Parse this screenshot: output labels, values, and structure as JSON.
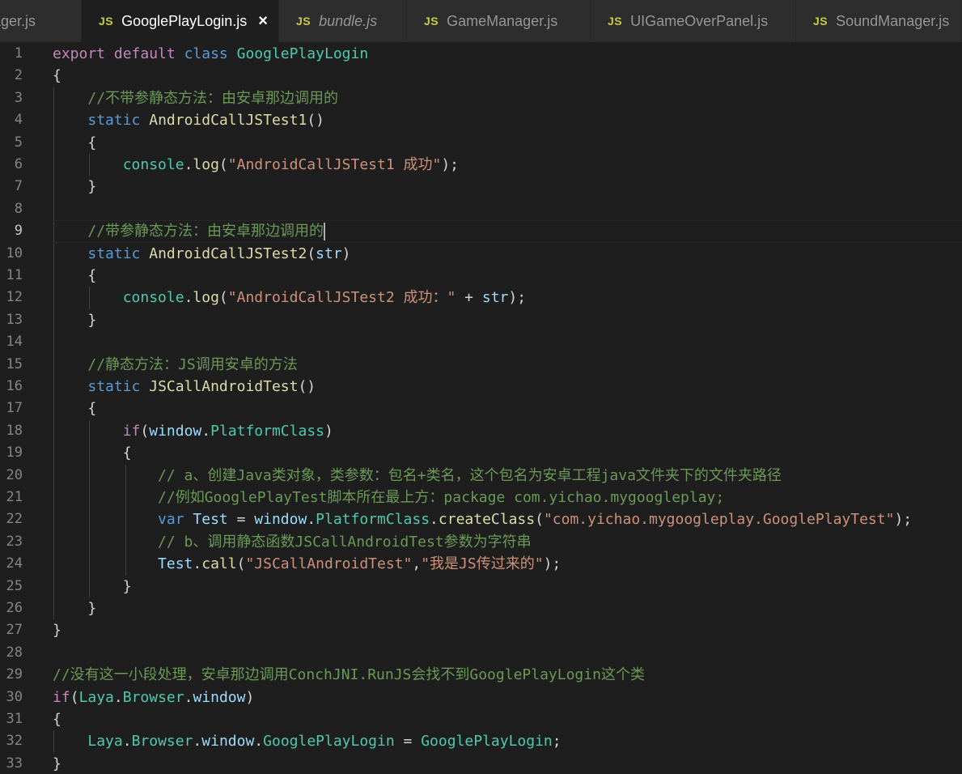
{
  "tabs": [
    {
      "label": "nager.js",
      "icon": "JS",
      "active": false,
      "italic": false
    },
    {
      "label": "GooglePlayLogin.js",
      "icon": "JS",
      "active": true,
      "italic": false,
      "close": "×"
    },
    {
      "label": "bundle.js",
      "icon": "JS",
      "active": false,
      "italic": true
    },
    {
      "label": "GameManager.js",
      "icon": "JS",
      "active": false,
      "italic": false
    },
    {
      "label": "UIGameOverPanel.js",
      "icon": "JS",
      "active": false,
      "italic": false
    },
    {
      "label": "SoundManager.js",
      "icon": "JS",
      "active": false,
      "italic": false
    }
  ],
  "editor": {
    "current_line": 9,
    "line_numbers": [
      "1",
      "2",
      "3",
      "4",
      "5",
      "6",
      "7",
      "8",
      "9",
      "10",
      "11",
      "12",
      "13",
      "14",
      "15",
      "16",
      "17",
      "18",
      "19",
      "20",
      "21",
      "22",
      "23",
      "24",
      "25",
      "26",
      "27",
      "28",
      "29",
      "30",
      "31",
      "32",
      "33"
    ],
    "lines": [
      [
        {
          "t": "kw",
          "v": "export"
        },
        {
          "t": "pl",
          "v": " "
        },
        {
          "t": "kw",
          "v": "default"
        },
        {
          "t": "pl",
          "v": " "
        },
        {
          "t": "st",
          "v": "class"
        },
        {
          "t": "pl",
          "v": " "
        },
        {
          "t": "cls",
          "v": "GooglePlayLogin"
        }
      ],
      [
        {
          "t": "pl",
          "v": "{"
        }
      ],
      [
        {
          "t": "pl",
          "v": "    "
        },
        {
          "t": "cmt",
          "v": "//不带参静态方法：由安卓那边调用的"
        }
      ],
      [
        {
          "t": "pl",
          "v": "    "
        },
        {
          "t": "st",
          "v": "static"
        },
        {
          "t": "pl",
          "v": " "
        },
        {
          "t": "fn",
          "v": "AndroidCallJSTest1"
        },
        {
          "t": "pl",
          "v": "()"
        }
      ],
      [
        {
          "t": "pl",
          "v": "    {"
        }
      ],
      [
        {
          "t": "pl",
          "v": "        "
        },
        {
          "t": "cls",
          "v": "console"
        },
        {
          "t": "pl",
          "v": "."
        },
        {
          "t": "fn",
          "v": "log"
        },
        {
          "t": "pl",
          "v": "("
        },
        {
          "t": "str",
          "v": "\"AndroidCallJSTest1 成功\""
        },
        {
          "t": "pl",
          "v": ");"
        }
      ],
      [
        {
          "t": "pl",
          "v": "    }"
        }
      ],
      [
        {
          "t": "pl",
          "v": ""
        }
      ],
      [
        {
          "t": "pl",
          "v": "    "
        },
        {
          "t": "cmt",
          "v": "//带参静态方法：由安卓那边调用的"
        }
      ],
      [
        {
          "t": "pl",
          "v": "    "
        },
        {
          "t": "st",
          "v": "static"
        },
        {
          "t": "pl",
          "v": " "
        },
        {
          "t": "fn",
          "v": "AndroidCallJSTest2"
        },
        {
          "t": "pl",
          "v": "("
        },
        {
          "t": "var",
          "v": "str"
        },
        {
          "t": "pl",
          "v": ")"
        }
      ],
      [
        {
          "t": "pl",
          "v": "    {"
        }
      ],
      [
        {
          "t": "pl",
          "v": "        "
        },
        {
          "t": "cls",
          "v": "console"
        },
        {
          "t": "pl",
          "v": "."
        },
        {
          "t": "fn",
          "v": "log"
        },
        {
          "t": "pl",
          "v": "("
        },
        {
          "t": "str",
          "v": "\"AndroidCallJSTest2 成功：\""
        },
        {
          "t": "pl",
          "v": " + "
        },
        {
          "t": "var",
          "v": "str"
        },
        {
          "t": "pl",
          "v": ");"
        }
      ],
      [
        {
          "t": "pl",
          "v": "    }"
        }
      ],
      [
        {
          "t": "pl",
          "v": ""
        }
      ],
      [
        {
          "t": "pl",
          "v": "    "
        },
        {
          "t": "cmt",
          "v": "//静态方法：JS调用安卓的方法"
        }
      ],
      [
        {
          "t": "pl",
          "v": "    "
        },
        {
          "t": "st",
          "v": "static"
        },
        {
          "t": "pl",
          "v": " "
        },
        {
          "t": "fn",
          "v": "JSCallAndroidTest"
        },
        {
          "t": "pl",
          "v": "()"
        }
      ],
      [
        {
          "t": "pl",
          "v": "    {"
        }
      ],
      [
        {
          "t": "pl",
          "v": "        "
        },
        {
          "t": "kw",
          "v": "if"
        },
        {
          "t": "pl",
          "v": "("
        },
        {
          "t": "var",
          "v": "window"
        },
        {
          "t": "pl",
          "v": "."
        },
        {
          "t": "cls",
          "v": "PlatformClass"
        },
        {
          "t": "pl",
          "v": ")"
        }
      ],
      [
        {
          "t": "pl",
          "v": "        {"
        }
      ],
      [
        {
          "t": "pl",
          "v": "            "
        },
        {
          "t": "cmt",
          "v": "// a、创建Java类对象，类参数：包名+类名，这个包名为安卓工程java文件夹下的文件夹路径"
        }
      ],
      [
        {
          "t": "pl",
          "v": "            "
        },
        {
          "t": "cmt",
          "v": "//例如GooglePlayTest脚本所在最上方：package com.yichao.mygoogleplay;"
        }
      ],
      [
        {
          "t": "pl",
          "v": "            "
        },
        {
          "t": "st",
          "v": "var"
        },
        {
          "t": "pl",
          "v": " "
        },
        {
          "t": "var",
          "v": "Test"
        },
        {
          "t": "pl",
          "v": " = "
        },
        {
          "t": "var",
          "v": "window"
        },
        {
          "t": "pl",
          "v": "."
        },
        {
          "t": "cls",
          "v": "PlatformClass"
        },
        {
          "t": "pl",
          "v": "."
        },
        {
          "t": "fn",
          "v": "createClass"
        },
        {
          "t": "pl",
          "v": "("
        },
        {
          "t": "str",
          "v": "\"com.yichao.mygoogleplay.GooglePlayTest\""
        },
        {
          "t": "pl",
          "v": ");"
        }
      ],
      [
        {
          "t": "pl",
          "v": "            "
        },
        {
          "t": "cmt",
          "v": "// b、调用静态函数JSCallAndroidTest参数为字符串"
        }
      ],
      [
        {
          "t": "pl",
          "v": "            "
        },
        {
          "t": "var",
          "v": "Test"
        },
        {
          "t": "pl",
          "v": "."
        },
        {
          "t": "fn",
          "v": "call"
        },
        {
          "t": "pl",
          "v": "("
        },
        {
          "t": "str",
          "v": "\"JSCallAndroidTest\""
        },
        {
          "t": "pl",
          "v": ","
        },
        {
          "t": "str",
          "v": "\"我是JS传过来的\""
        },
        {
          "t": "pl",
          "v": ");"
        }
      ],
      [
        {
          "t": "pl",
          "v": "        }"
        }
      ],
      [
        {
          "t": "pl",
          "v": "    }"
        }
      ],
      [
        {
          "t": "pl",
          "v": "}"
        }
      ],
      [
        {
          "t": "pl",
          "v": ""
        }
      ],
      [
        {
          "t": "cmt",
          "v": "//没有这一小段处理，安卓那边调用ConchJNI.RunJS会找不到GooglePlayLogin这个类"
        }
      ],
      [
        {
          "t": "kw",
          "v": "if"
        },
        {
          "t": "pl",
          "v": "("
        },
        {
          "t": "cls",
          "v": "Laya"
        },
        {
          "t": "pl",
          "v": "."
        },
        {
          "t": "cls",
          "v": "Browser"
        },
        {
          "t": "pl",
          "v": "."
        },
        {
          "t": "var",
          "v": "window"
        },
        {
          "t": "pl",
          "v": ")"
        }
      ],
      [
        {
          "t": "pl",
          "v": "{"
        }
      ],
      [
        {
          "t": "pl",
          "v": "    "
        },
        {
          "t": "cls",
          "v": "Laya"
        },
        {
          "t": "pl",
          "v": "."
        },
        {
          "t": "cls",
          "v": "Browser"
        },
        {
          "t": "pl",
          "v": "."
        },
        {
          "t": "var",
          "v": "window"
        },
        {
          "t": "pl",
          "v": "."
        },
        {
          "t": "cls",
          "v": "GooglePlayLogin"
        },
        {
          "t": "pl",
          "v": " = "
        },
        {
          "t": "cls",
          "v": "GooglePlayLogin"
        },
        {
          "t": "pl",
          "v": ";"
        }
      ],
      [
        {
          "t": "pl",
          "v": "}"
        }
      ]
    ]
  }
}
